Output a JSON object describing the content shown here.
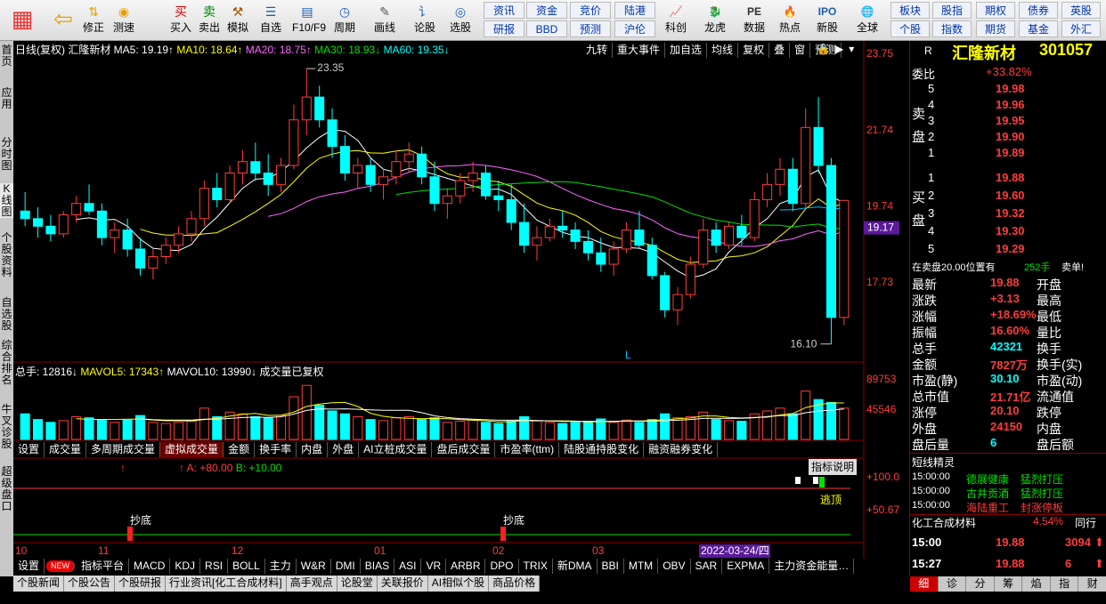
{
  "toolbar": {
    "buttons": [
      {
        "label": "",
        "icon": "grid-icon"
      },
      {
        "label": "",
        "icon": "back-arrow-icon"
      },
      {
        "label": "修正",
        "icon": "arrow-up-down-icon"
      },
      {
        "label": "测速",
        "icon": "speed-icon"
      },
      {
        "label": "买入",
        "icon": "buy-icon"
      },
      {
        "label": "卖出",
        "icon": "sell-icon"
      },
      {
        "label": "模拟",
        "icon": "hammer-icon"
      },
      {
        "label": "自选",
        "icon": "folder-icon"
      },
      {
        "label": "F10/F9",
        "icon": "card-icon"
      },
      {
        "label": "周期",
        "icon": "clock-icon"
      },
      {
        "label": "画线",
        "icon": "pencil-icon"
      },
      {
        "label": "论股",
        "icon": "chat-icon"
      },
      {
        "label": "选股",
        "icon": "filter-icon"
      }
    ],
    "small_buttons_row1": [
      "资讯",
      "资金",
      "竞价",
      "陆港"
    ],
    "small_buttons_row2": [
      "研报",
      "BBD",
      "预测",
      "沪伦"
    ],
    "icon_buttons": [
      {
        "label": "科创",
        "icon": "chart-icon"
      },
      {
        "label": "龙虎",
        "icon": "dragon-icon"
      },
      {
        "label": "数据",
        "icon": "pe-icon"
      },
      {
        "label": "热点",
        "icon": "hot-icon"
      },
      {
        "label": "新股",
        "icon": "ipo-icon"
      },
      {
        "label": "全球",
        "icon": "globe-icon"
      }
    ],
    "right_row1": [
      "板块",
      "股指",
      "期权",
      "债券",
      "英股"
    ],
    "right_row2": [
      "个股",
      "指数",
      "期货",
      "基金",
      "外汇"
    ]
  },
  "leftbar": [
    "首页",
    "应用",
    "分时图",
    "K线图",
    "个股资料",
    "自选股",
    "综合排名",
    "牛叉诊股",
    "超级盘口"
  ],
  "kline_header": {
    "title": "日线(复权)  汇隆新材",
    "ma5": "MA5: 19.19↑",
    "ma10": "MA10: 18.64↑",
    "ma20": "MA20: 18.75↑",
    "ma30": "MA30: 18.93↓",
    "ma60": "MA60: 19.35↓",
    "right_buttons": [
      "九转",
      "重大事件",
      "加自选",
      "均线",
      "复权",
      "叠",
      "窗",
      "预测"
    ]
  },
  "price_axis": [
    "23.75",
    "21.74",
    "19.74",
    "17.73"
  ],
  "current_price_tag": "19.17",
  "annot_high": "23.35",
  "annot_low": "16.10",
  "marker_L": "L",
  "volume_header": {
    "total": "总手: 12816↓",
    "mavol5": "MAVOL5: 17343↑",
    "mavol10": "MAVOL10: 13990↓",
    "note": "成交量已复权"
  },
  "vol_axis": [
    "89753",
    "45546"
  ],
  "sub_tabs": [
    "设置",
    "成交量",
    "多周期成交量",
    "虚拟成交量",
    "金额",
    "换手率",
    "内盘",
    "外盘",
    "AI立桩成交量",
    "盘后成交量",
    "市盈率(ttm)",
    "陆股通持股变化",
    "融资融券变化"
  ],
  "indicator": {
    "a": "A: +80.00",
    "b": "B: +10.00",
    "explain": "指标说明",
    "axis1": "+100.0",
    "axis2": "+50.67",
    "escape": "逃顶",
    "bottom1": "抄底",
    "bottom2": "抄底"
  },
  "date_axis": [
    "10",
    "11",
    "12",
    "01",
    "02",
    "03"
  ],
  "date_highlight": "2022-03-24/四",
  "indicator_tabs": [
    "设置",
    "NEW",
    "指标平台",
    "MACD",
    "KDJ",
    "RSI",
    "BOLL",
    "主力",
    "W&R",
    "DMI",
    "BIAS",
    "ASI",
    "VR",
    "ARBR",
    "DPO",
    "TRIX",
    "新DMA",
    "BBI",
    "MTM",
    "OBV",
    "SAR",
    "EXPMA",
    "主力资金能量…"
  ],
  "news_tabs": [
    "个股新闻",
    "个股公告",
    "个股研报",
    "行业资讯[化工合成材料]",
    "高手观点",
    "论股堂",
    "关联报价",
    "AI相似个股",
    "商品价格"
  ],
  "quote": {
    "r": "R",
    "name": "汇隆新材",
    "code": "301057",
    "weibi_label": "委比",
    "weibi": "+33.82%",
    "sell": [
      {
        "n": "5",
        "p": "19.98"
      },
      {
        "n": "4",
        "p": "19.96"
      },
      {
        "n": "3",
        "p": "19.95"
      },
      {
        "n": "2",
        "p": "19.90"
      },
      {
        "n": "1",
        "p": "19.89"
      }
    ],
    "buy": [
      {
        "n": "1",
        "p": "19.88"
      },
      {
        "n": "2",
        "p": "19.60"
      },
      {
        "n": "3",
        "p": "19.32"
      },
      {
        "n": "4",
        "p": "19.30"
      },
      {
        "n": "5",
        "p": "19.29"
      }
    ],
    "sell_label": "卖盘",
    "buy_label": "买盘",
    "pending": "在卖盘20.00位置有",
    "pending_qty": "252手",
    "pending_tag": "卖单!",
    "rows": [
      {
        "l": "最新",
        "v": "19.88",
        "r": "开盘"
      },
      {
        "l": "涨跌",
        "v": "+3.13",
        "r": "最高"
      },
      {
        "l": "涨幅",
        "v": "+18.69%",
        "r": "最低"
      },
      {
        "l": "振幅",
        "v": "16.60%",
        "r": "量比"
      },
      {
        "l": "总手",
        "v": "42321",
        "r": "换手"
      },
      {
        "l": "金额",
        "v": "7827万",
        "r": "换手(实)"
      },
      {
        "l": "市盈(静)",
        "v": "30.10",
        "r": "市盈(动)"
      },
      {
        "l": "总市值",
        "v": "21.71亿",
        "r": "流通值"
      },
      {
        "l": "涨停",
        "v": "20.10",
        "r": "跌停"
      },
      {
        "l": "外盘",
        "v": "24150",
        "r": "内盘"
      },
      {
        "l": "盘后量",
        "v": "6",
        "r": "盘后额"
      }
    ],
    "short_title": "短线精灵",
    "short": [
      {
        "t": "15:00:00",
        "n": "德展健康",
        "e": "猛烈打压"
      },
      {
        "t": "15:00:00",
        "n": "古井贡酒",
        "e": "猛烈打压"
      },
      {
        "t": "15:00:00",
        "n": "海陆重工",
        "e": "封涨停板"
      }
    ],
    "industry": "化工合成材料",
    "industry_pct": "4.54%",
    "industry_more": "同行",
    "ticks": [
      {
        "t": "15:00",
        "p": "19.88",
        "v": "3094"
      },
      {
        "t": "15:27",
        "p": "19.88",
        "v": "6"
      }
    ],
    "bottom_tabs": [
      "细",
      "诊",
      "分",
      "筹",
      "焰",
      "指",
      "财"
    ]
  },
  "chart_data": {
    "type": "candlestick",
    "ylim": [
      16.0,
      23.75
    ],
    "ohlc": [
      [
        19.6,
        20.1,
        19.2,
        19.4
      ],
      [
        19.4,
        19.7,
        18.9,
        19.2
      ],
      [
        19.2,
        19.5,
        18.8,
        19.0
      ],
      [
        19.0,
        19.6,
        18.9,
        19.5
      ],
      [
        19.5,
        20.0,
        19.3,
        19.8
      ],
      [
        19.8,
        20.3,
        19.5,
        19.6
      ],
      [
        19.6,
        19.8,
        18.7,
        18.9
      ],
      [
        18.9,
        19.3,
        18.5,
        19.1
      ],
      [
        19.1,
        19.4,
        18.4,
        18.6
      ],
      [
        18.6,
        18.9,
        17.9,
        18.1
      ],
      [
        18.1,
        18.6,
        17.8,
        18.4
      ],
      [
        18.4,
        18.9,
        18.2,
        18.7
      ],
      [
        18.7,
        19.2,
        18.5,
        19.0
      ],
      [
        19.0,
        19.6,
        18.8,
        19.4
      ],
      [
        19.4,
        20.4,
        19.2,
        20.2
      ],
      [
        20.2,
        20.6,
        19.7,
        19.9
      ],
      [
        19.9,
        20.8,
        19.8,
        20.6
      ],
      [
        20.6,
        21.2,
        20.3,
        20.9
      ],
      [
        20.9,
        21.4,
        20.4,
        20.6
      ],
      [
        20.6,
        21.1,
        20.0,
        20.3
      ],
      [
        20.3,
        21.0,
        20.1,
        20.8
      ],
      [
        20.8,
        22.4,
        20.7,
        22.0
      ],
      [
        22.0,
        23.35,
        21.6,
        22.6
      ],
      [
        22.6,
        22.9,
        21.8,
        22.0
      ],
      [
        22.0,
        22.3,
        21.0,
        21.3
      ],
      [
        21.3,
        21.6,
        20.4,
        20.6
      ],
      [
        20.6,
        21.0,
        20.2,
        20.8
      ],
      [
        20.8,
        21.0,
        20.1,
        20.3
      ],
      [
        20.3,
        20.7,
        19.9,
        20.5
      ],
      [
        20.5,
        21.2,
        20.3,
        20.9
      ],
      [
        20.9,
        21.4,
        20.6,
        21.1
      ],
      [
        21.1,
        21.3,
        20.3,
        20.5
      ],
      [
        20.5,
        20.9,
        19.6,
        19.8
      ],
      [
        19.8,
        20.2,
        19.4,
        20.0
      ],
      [
        20.0,
        20.6,
        19.8,
        20.4
      ],
      [
        20.4,
        20.9,
        20.1,
        20.6
      ],
      [
        20.6,
        20.8,
        19.9,
        20.0
      ],
      [
        20.0,
        20.4,
        19.6,
        19.9
      ],
      [
        19.9,
        20.3,
        19.1,
        19.3
      ],
      [
        19.3,
        19.8,
        18.5,
        18.7
      ],
      [
        18.7,
        19.2,
        18.3,
        18.9
      ],
      [
        18.9,
        19.4,
        18.8,
        19.2
      ],
      [
        19.2,
        19.6,
        18.9,
        19.1
      ],
      [
        19.1,
        19.3,
        18.6,
        18.8
      ],
      [
        18.8,
        19.1,
        18.3,
        18.5
      ],
      [
        18.5,
        18.9,
        18.0,
        18.2
      ],
      [
        18.2,
        18.8,
        17.9,
        18.6
      ],
      [
        18.6,
        19.3,
        18.5,
        19.1
      ],
      [
        19.1,
        19.6,
        18.6,
        18.7
      ],
      [
        18.7,
        18.9,
        17.8,
        17.9
      ],
      [
        17.9,
        18.0,
        16.8,
        17.0
      ],
      [
        17.0,
        17.6,
        16.6,
        17.4
      ],
      [
        17.4,
        18.4,
        17.3,
        18.2
      ],
      [
        18.2,
        19.4,
        18.1,
        19.1
      ],
      [
        19.1,
        19.3,
        18.5,
        18.7
      ],
      [
        18.7,
        19.3,
        18.6,
        19.2
      ],
      [
        19.2,
        19.5,
        18.7,
        18.9
      ],
      [
        18.9,
        20.1,
        18.8,
        19.9
      ],
      [
        19.9,
        20.6,
        19.7,
        20.3
      ],
      [
        20.3,
        21.0,
        20.0,
        20.7
      ],
      [
        20.7,
        21.0,
        19.6,
        19.8
      ],
      [
        19.8,
        22.3,
        19.7,
        21.8
      ],
      [
        21.8,
        22.6,
        20.6,
        20.8
      ],
      [
        20.8,
        21.0,
        16.1,
        16.8
      ],
      [
        16.8,
        19.3,
        16.6,
        19.88
      ]
    ],
    "volume": [
      0.45,
      0.35,
      0.3,
      0.33,
      0.4,
      0.38,
      0.35,
      0.3,
      0.34,
      0.42,
      0.3,
      0.28,
      0.3,
      0.32,
      0.55,
      0.4,
      0.48,
      0.45,
      0.4,
      0.38,
      0.42,
      0.75,
      0.95,
      0.6,
      0.5,
      0.45,
      0.4,
      0.35,
      0.33,
      0.38,
      0.4,
      0.35,
      0.38,
      0.3,
      0.32,
      0.34,
      0.3,
      0.28,
      0.32,
      0.4,
      0.33,
      0.3,
      0.28,
      0.3,
      0.32,
      0.36,
      0.3,
      0.34,
      0.3,
      0.35,
      0.45,
      0.38,
      0.4,
      0.48,
      0.35,
      0.33,
      0.32,
      0.45,
      0.5,
      0.55,
      0.45,
      0.85,
      0.7,
      0.65,
      0.55
    ]
  }
}
